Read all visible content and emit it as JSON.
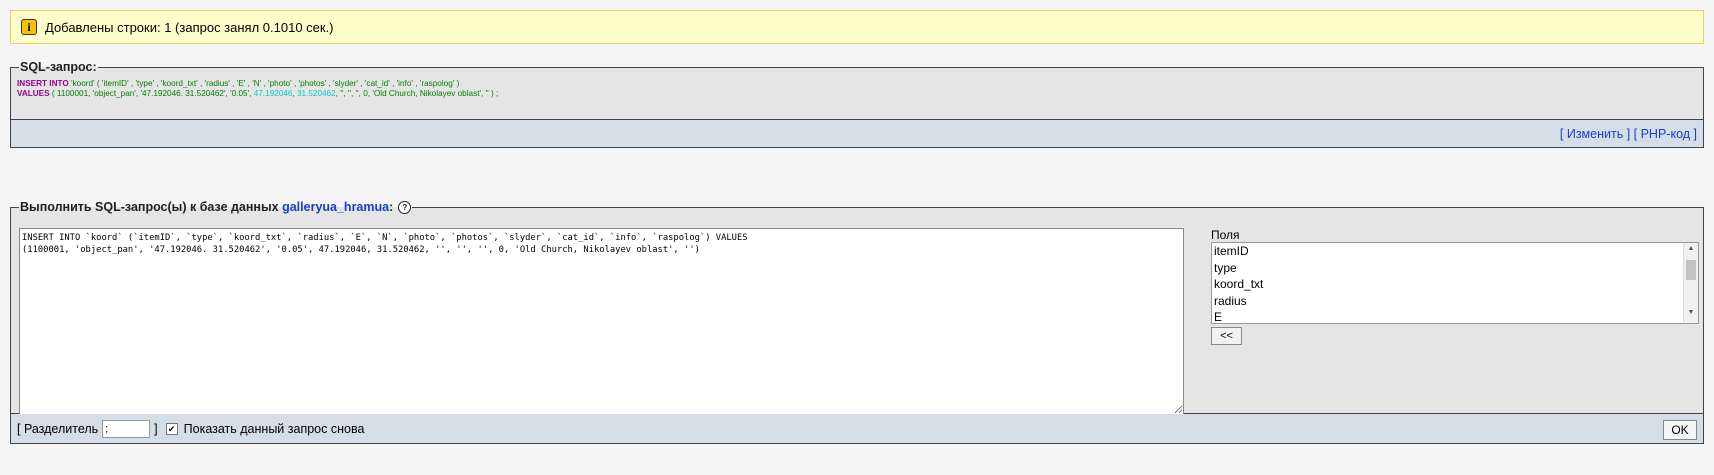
{
  "notice": {
    "icon": "info-icon",
    "text": "Добавлены строки: 1 (запрос занял 0.1010 сек.)"
  },
  "sql_query": {
    "legend": "SQL-запрос:",
    "line1": {
      "kw": "INSERT INTO",
      "rest": " 'koord' ( 'itemID' , 'type' , 'koord_txt' , 'radius' , 'E' , 'N' , 'photo' , 'photos' , 'slyder' , 'cat_id' , 'info' , 'raspolog' )"
    },
    "line2": {
      "kw": "VALUES",
      "part1": " ( 1100001, 'object_pan', '47.192046. 31.520462', '0.05', ",
      "num1": "47.192046",
      "sep": ", ",
      "num2": "31.520462",
      "part2": ", '', '', '', 0, 'Old Church, Nikolayev oblast', '' ) ;"
    },
    "links": {
      "edit": "Изменить",
      "php": "PHP-код"
    }
  },
  "run_sql": {
    "legend_prefix": "Выполнить SQL-запрос(ы) к базе данных ",
    "database": "galleryua_hramua",
    "legend_suffix": ":",
    "help_icon": "help-icon",
    "textarea_value": "INSERT INTO `koord` (`itemID`, `type`, `koord_txt`, `radius`, `E`, `N`, `photo`, `photos`, `slyder`, `cat_id`, `info`, `raspolog`) VALUES\n(1100001, 'object_pan', '47.192046. 31.520462', '0.05', 47.192046, 31.520462, '', '', '', 0, 'Old Church, Nikolayev oblast', '')",
    "fields_label": "Поля",
    "fields": [
      "itemID",
      "type",
      "koord_txt",
      "radius",
      "E"
    ],
    "insert_button": "<<",
    "delimiter_label_open": "[ Разделитель",
    "delimiter_value": ";",
    "delimiter_label_close": "]",
    "show_again_checked": true,
    "show_again_label": "Показать данный запрос снова",
    "ok_button": "OK"
  }
}
